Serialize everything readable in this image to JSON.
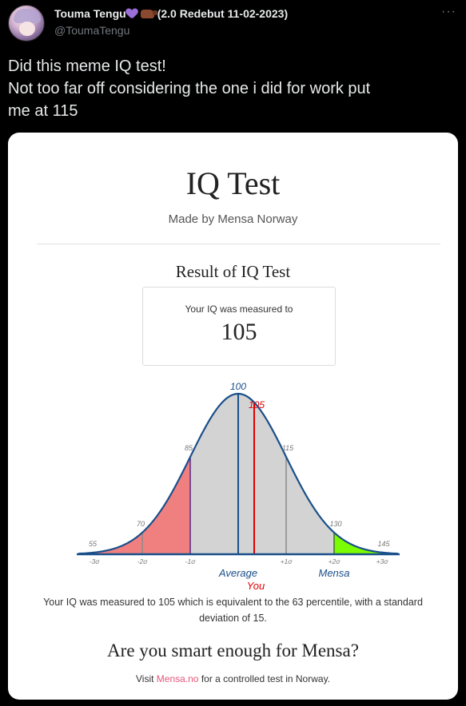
{
  "tweet": {
    "display_name": "Touma Tengu",
    "name_suffix": "(2.0 Redebut 11-02-2023)",
    "handle": "@ToumaTengu",
    "more_icon": "···",
    "text_lines": [
      "Did this meme IQ test!",
      "Not too far off considering the one i did for work put",
      "me at 115"
    ]
  },
  "card": {
    "title": "IQ Test",
    "subtitle": "Made by Mensa Norway",
    "result_title": "Result of IQ Test",
    "result_label": "Your IQ was measured to",
    "result_value": "105",
    "explanation": "Your IQ was measured to 105 which is equivalent to the 63 percentile, with a standard deviation of 15.",
    "mensa_question": "Are you smart enough for Mensa?",
    "visit_prefix": "Visit",
    "visit_link": "Mensa.no",
    "visit_suffix": "for a controlled test in Norway."
  },
  "chart_data": {
    "type": "area",
    "mean": 100,
    "sd": 15,
    "user_score": 105,
    "mensa_threshold": 130,
    "xlim": [
      50,
      150
    ],
    "score_labels": [
      {
        "x": 55,
        "label": "55"
      },
      {
        "x": 70,
        "label": "70"
      },
      {
        "x": 85,
        "label": "85"
      },
      {
        "x": 100,
        "label": "100"
      },
      {
        "x": 105,
        "label": "105"
      },
      {
        "x": 115,
        "label": "115"
      },
      {
        "x": 130,
        "label": "130"
      },
      {
        "x": 145,
        "label": "145"
      }
    ],
    "sigma_ticks": [
      {
        "x": 55,
        "label": "-3σ"
      },
      {
        "x": 70,
        "label": "-2σ"
      },
      {
        "x": 85,
        "label": "-1σ"
      },
      {
        "x": 115,
        "label": "+1σ"
      },
      {
        "x": 130,
        "label": "+2σ"
      },
      {
        "x": 145,
        "label": "+3σ"
      }
    ],
    "annotations": [
      {
        "x": 100,
        "label": "Average"
      },
      {
        "x": 105,
        "label": "You"
      },
      {
        "x": 130,
        "label": "Mensa"
      }
    ],
    "colors": {
      "left_tail": "#f08080",
      "body": "#d3d3d3",
      "mensa_tail": "#7cfc00",
      "curve": "#1a4f8a",
      "mean_line": "#1a4f8a",
      "user_line": "#e00000",
      "minus_sigma_line": "#5b2a86",
      "gray_line": "#8a8a8a",
      "axis_text": "#777777",
      "average_text": "#1a4f8a",
      "you_text": "#e00000"
    }
  }
}
